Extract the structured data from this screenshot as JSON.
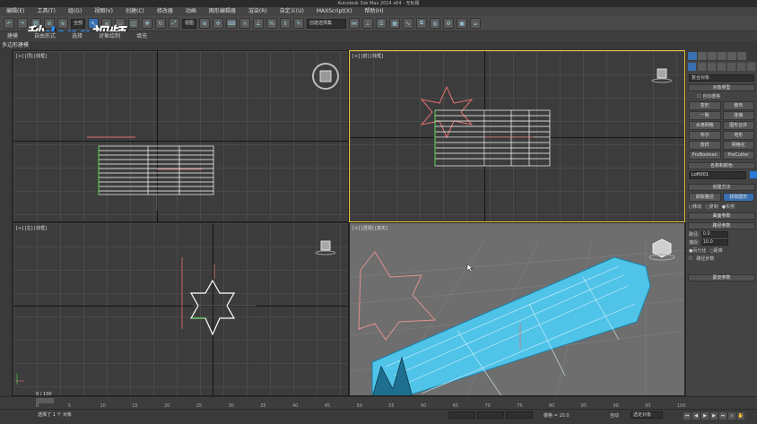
{
  "title": "Autodesk 3ds Max 2014 x64 - 无标题",
  "menu": [
    "编辑(E)",
    "工具(T)",
    "组(G)",
    "视图(V)",
    "创建(C)",
    "修改器",
    "动画",
    "图形编辑器",
    "渲染(R)",
    "自定义(U)",
    "MAXScript(X)",
    "帮助(H)"
  ],
  "toolbar": {
    "filter": "全部",
    "view": "视图",
    "selection_set": "创建选择集"
  },
  "ribbon": [
    "建模",
    "自由形式",
    "选择",
    "对象绘制",
    "填充"
  ],
  "ribbon_sub": "多边形建模",
  "watermark": {
    "part1": "秒",
    "part2": "dong",
    "part3": "视频"
  },
  "viewports": {
    "top": "[+] [顶] [线框]",
    "front": "[+] [前] [线框]",
    "left": "[+] [左] [线框]",
    "persp": "[+] [透视] [真实]"
  },
  "command_panel": {
    "category": "复合对象",
    "object_type": "对象类型",
    "autogrid": "自动栅格",
    "buttons": [
      "变形",
      "散布",
      "一致",
      "连接",
      "水滴网格",
      "图形合并",
      "布尔",
      "地形",
      "放样",
      "网格化",
      "ProBoolean",
      "ProCutter"
    ],
    "name_color": "名称和颜色",
    "object_name": "Loft001",
    "creation_method": "创建方法",
    "get_path": "获取路径",
    "get_shape": "获取图形",
    "radios": [
      "移动",
      "复制",
      "实例"
    ],
    "surface_params": "曲面参数",
    "path_params": "路径参数",
    "path_label": "路径:",
    "path_value": "0.0",
    "snap_label": "捕捉:",
    "snap_value": "10.0",
    "percent": "百分比",
    "distance": "距离",
    "path_steps": "路径步数",
    "skin_params": "蒙皮参数"
  },
  "timeline": {
    "frame": "0 / 100",
    "ticks": [
      "0",
      "5",
      "10",
      "15",
      "20",
      "25",
      "30",
      "35",
      "40",
      "45",
      "50",
      "55",
      "60",
      "65",
      "70",
      "75",
      "80",
      "85",
      "90",
      "95",
      "100"
    ]
  },
  "status": {
    "selection": "选择了 1 个 对象",
    "grid": "栅格 = 10.0",
    "auto": "自动",
    "select_obj": "选定对象"
  },
  "colors": {
    "accent": "#3a6fb0",
    "active_border": "#e7c23d",
    "loft": "#4fc3e8",
    "shape": "#e07070"
  }
}
